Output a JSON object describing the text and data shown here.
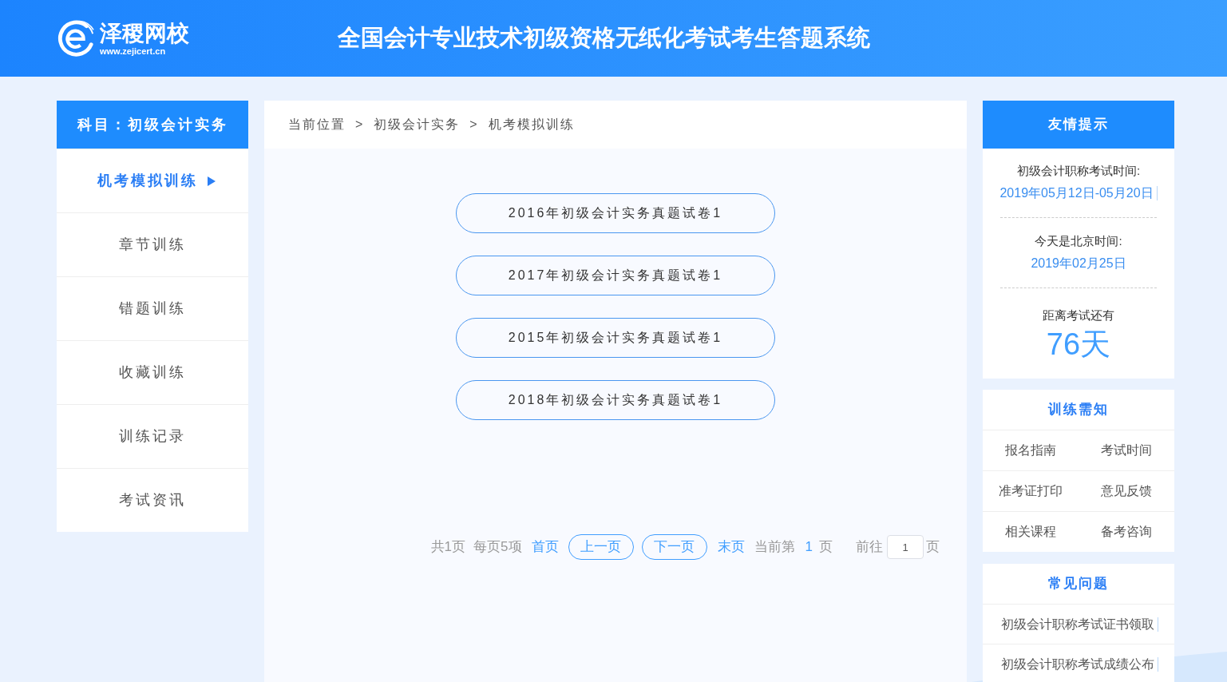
{
  "header": {
    "logo": {
      "name": "泽稷网校",
      "url": "www.zejicert.cn"
    },
    "title": "全国会计专业技术初级资格无纸化考试考生答题系统"
  },
  "sidebar": {
    "title": "科目：初级会计实务",
    "items": [
      {
        "label": "机考模拟训练",
        "selected": true
      },
      {
        "label": "章节训练",
        "selected": false
      },
      {
        "label": "错题训练",
        "selected": false
      },
      {
        "label": "收藏训练",
        "selected": false
      },
      {
        "label": "训练记录",
        "selected": false
      },
      {
        "label": "考试资讯",
        "selected": false
      }
    ]
  },
  "breadcrumb": [
    "当前位置",
    ">",
    "初级会计实务",
    ">",
    "机考模拟训练"
  ],
  "papers": [
    {
      "title": "2016年初级会计实务真题试卷1"
    },
    {
      "title": "2017年初级会计实务真题试卷1"
    },
    {
      "title": "2015年初级会计实务真题试卷1"
    },
    {
      "title": "2018年初级会计实务真题试卷1"
    }
  ],
  "pagination": {
    "total_pages": "共1页",
    "per_page": "每页5项",
    "first": "首页",
    "prev": "上一页",
    "next": "下一页",
    "last": "末页",
    "current_prefix": "当前第",
    "current": "1",
    "current_suffix": "页",
    "goto_prefix": "前往",
    "goto_value": "1",
    "goto_suffix": "页"
  },
  "tips": {
    "title": "友情提示",
    "sections": [
      {
        "kind": "date",
        "label": "初级会计职称考试时间:",
        "value": "2019年05月12日-05月20日",
        "cursor": true
      },
      {
        "kind": "date",
        "label": "今天是北京时间:",
        "value": "2019年02月25日",
        "cursor": false
      },
      {
        "kind": "countdown",
        "label": "距离考试还有",
        "value": "76天"
      }
    ]
  },
  "guide": {
    "title": "训练需知",
    "links": [
      "报名指南",
      "考试时间",
      "准考证打印",
      "意见反馈",
      "相关课程",
      "备考咨询"
    ]
  },
  "faq": {
    "title": "常见问题",
    "items": [
      "初级会计职称考试证书领取",
      "初级会计职称考试成绩公布"
    ]
  }
}
